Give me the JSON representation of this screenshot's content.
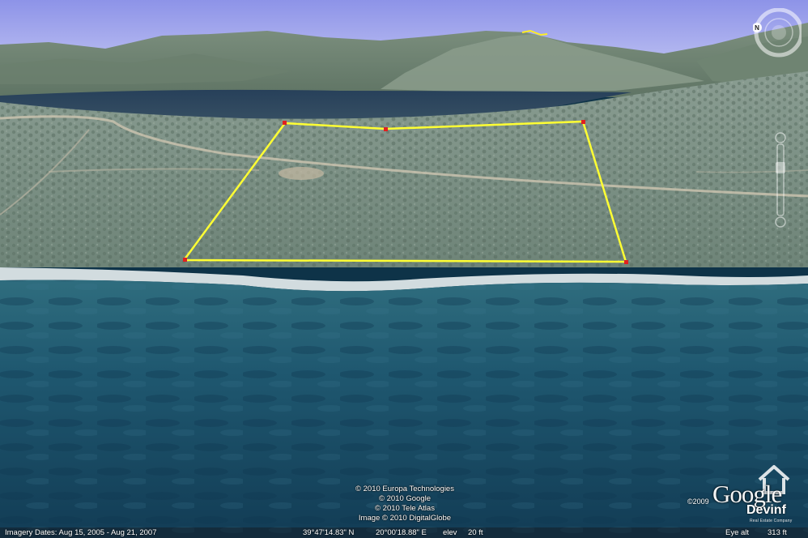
{
  "map": {
    "view": "3D perspective aerial view of coastline with outlined land parcel",
    "parcel_outline_color": "#ffff33",
    "vertex_color": "#e02020"
  },
  "attribution": {
    "lines": [
      "© 2010 Europa Technologies",
      "© 2010 Google",
      "© 2010 Tele Atlas",
      "Image © 2010 DigitalGlobe"
    ]
  },
  "status_bar": {
    "imagery_dates": "Imagery Dates: Aug 15, 2005 - Aug 21, 2007",
    "latitude": "39°47'14.83\" N",
    "longitude": "20°00'18.88\" E",
    "elev_label": "elev",
    "elev_value": "20 ft",
    "eye_alt_label": "Eye alt",
    "eye_alt_value": "313 ft"
  },
  "navigation": {
    "compass_letter": "N",
    "icons": [
      "compass-ring-icon",
      "look-joystick-icon",
      "zoom-slider-icon"
    ]
  },
  "branding": {
    "copyright_year": "©2009",
    "google_logo": "Google",
    "watermark_name": "Devinf",
    "watermark_tagline": "Real Estate Company"
  }
}
